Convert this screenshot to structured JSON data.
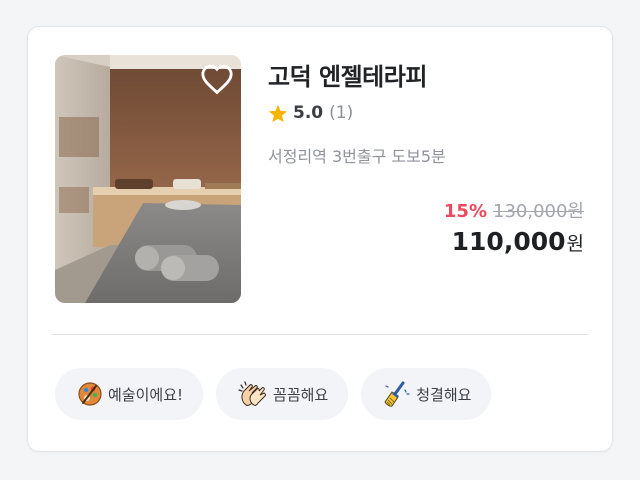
{
  "listing": {
    "title": "고덕 엔젤테라피",
    "rating": "5.0",
    "review_count": "(1)",
    "location": "서정리역 3번출구 도보5분",
    "discount": "15%",
    "original_price": "130,000원",
    "final_price": "110,000",
    "currency_unit": "원",
    "favorite_icon": "heart-outline-icon",
    "star_color": "#f7b500",
    "discount_color": "#ee4a5d"
  },
  "tags": [
    {
      "label": "예술이에요!",
      "icon": "art-palette-icon"
    },
    {
      "label": "꼼꼼해요",
      "icon": "clapping-hands-icon"
    },
    {
      "label": "청결해요",
      "icon": "broom-icon"
    }
  ]
}
